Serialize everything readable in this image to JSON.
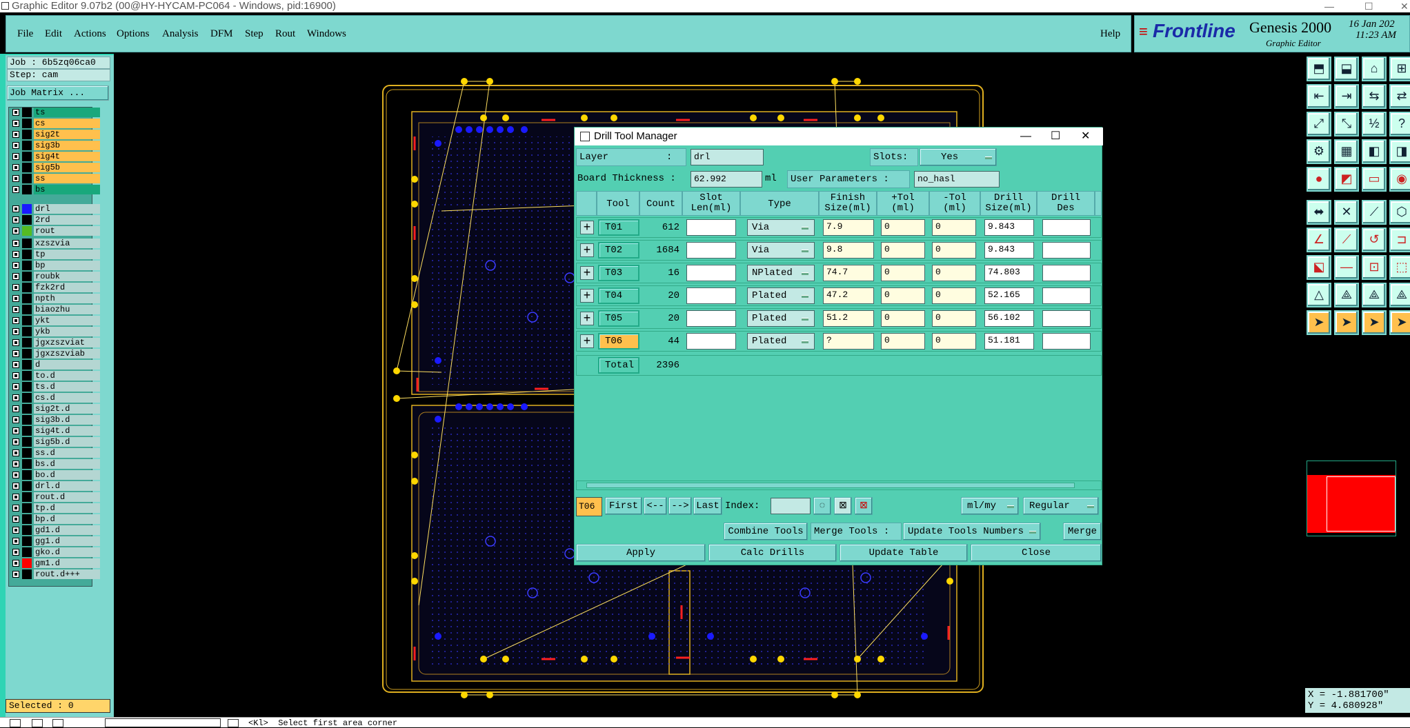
{
  "window": {
    "title": "Graphic Editor 9.07b2 (00@HY-HYCAM-PC064 - Windows, pid:16900)"
  },
  "menu": {
    "items": [
      "File",
      "Edit",
      "Actions",
      "Options",
      "Analysis",
      "DFM",
      "Step",
      "Rout",
      "Windows"
    ],
    "help": "Help"
  },
  "brand": {
    "logo": "Frontline",
    "product": "Genesis 2000",
    "subtitle": "Graphic Editor",
    "date": "16 Jan 202",
    "time": "11:23 AM"
  },
  "job": {
    "job_line": "Job : 6b5zq06ca0",
    "step_line": "Step: cam",
    "matrix_button": "Job Matrix ..."
  },
  "layers": [
    {
      "name": "ts",
      "color": "#19a87c"
    },
    {
      "name": "cs",
      "color": "#ffc04d"
    },
    {
      "name": "sig2t",
      "color": "#ffc04d"
    },
    {
      "name": "sig3b",
      "color": "#ffc04d"
    },
    {
      "name": "sig4t",
      "color": "#ffc04d"
    },
    {
      "name": "sig5b",
      "color": "#ffc04d"
    },
    {
      "name": "ss",
      "color": "#ffc04d"
    },
    {
      "name": "bs",
      "color": "#19a87c"
    },
    {
      "name": "drl",
      "color": "#b4d6d2",
      "swatch": "#1a1aff"
    },
    {
      "name": "2rd",
      "color": "#b4d6d2"
    },
    {
      "name": "rout",
      "color": "#b4d6d2",
      "swatch": "#55bb22"
    },
    {
      "name": "xzszvia",
      "color": "#b4d6d2"
    },
    {
      "name": "tp",
      "color": "#b4d6d2"
    },
    {
      "name": "bp",
      "color": "#b4d6d2"
    },
    {
      "name": "roubk",
      "color": "#b4d6d2"
    },
    {
      "name": "fzk2rd",
      "color": "#b4d6d2"
    },
    {
      "name": "npth",
      "color": "#b4d6d2"
    },
    {
      "name": "biaozhu",
      "color": "#b4d6d2"
    },
    {
      "name": "ykt",
      "color": "#b4d6d2"
    },
    {
      "name": "ykb",
      "color": "#b4d6d2"
    },
    {
      "name": "jgxzszviat",
      "color": "#b4d6d2"
    },
    {
      "name": "jgxzszviab",
      "color": "#b4d6d2"
    },
    {
      "name": "d",
      "color": "#b4d6d2"
    },
    {
      "name": "to.d",
      "color": "#b4d6d2"
    },
    {
      "name": "ts.d",
      "color": "#b4d6d2"
    },
    {
      "name": "cs.d",
      "color": "#b4d6d2"
    },
    {
      "name": "sig2t.d",
      "color": "#b4d6d2"
    },
    {
      "name": "sig3b.d",
      "color": "#b4d6d2"
    },
    {
      "name": "sig4t.d",
      "color": "#b4d6d2"
    },
    {
      "name": "sig5b.d",
      "color": "#b4d6d2"
    },
    {
      "name": "ss.d",
      "color": "#b4d6d2"
    },
    {
      "name": "bs.d",
      "color": "#b4d6d2"
    },
    {
      "name": "bo.d",
      "color": "#b4d6d2"
    },
    {
      "name": "drl.d",
      "color": "#b4d6d2"
    },
    {
      "name": "rout.d",
      "color": "#b4d6d2"
    },
    {
      "name": "tp.d",
      "color": "#b4d6d2"
    },
    {
      "name": "bp.d",
      "color": "#b4d6d2"
    },
    {
      "name": "gd1.d",
      "color": "#b4d6d2"
    },
    {
      "name": "gg1.d",
      "color": "#b4d6d2"
    },
    {
      "name": "gko.d",
      "color": "#b4d6d2"
    },
    {
      "name": "gm1.d",
      "color": "#b4d6d2",
      "swatch": "#ff0000"
    },
    {
      "name": "rout.d+++",
      "color": "#b4d6d2"
    }
  ],
  "selected": "Selected : 0",
  "coords": {
    "x": "X = -1.881700\"",
    "y": "Y = 4.680928\""
  },
  "dialog": {
    "title": "Drill Tool Manager",
    "layer_label": "Layer          :",
    "layer_value": "drl",
    "slots_label": "Slots:",
    "slots_value": "Yes",
    "thickness_label": "Board Thickness :",
    "thickness_value": "62.992",
    "thickness_unit": "ml",
    "user_params_label": "User Parameters :",
    "user_params_value": "no_hasl",
    "headers": [
      "Tool",
      "Count",
      "Slot\nLen(ml)",
      "Type",
      "Finish\nSize(ml)",
      "+Tol\n(ml)",
      "-Tol\n(ml)",
      "Drill\nSize(ml)",
      "Drill\nDes"
    ],
    "rows": [
      {
        "tool": "T01",
        "count": "612",
        "slot": "",
        "type": "Via",
        "finish": "7.9",
        "ptol": "0",
        "mtol": "0",
        "drill": "9.843",
        "des": ""
      },
      {
        "tool": "T02",
        "count": "1684",
        "slot": "",
        "type": "Via",
        "finish": "9.8",
        "ptol": "0",
        "mtol": "0",
        "drill": "9.843",
        "des": ""
      },
      {
        "tool": "T03",
        "count": "16",
        "slot": "",
        "type": "NPlated",
        "finish": "74.7",
        "ptol": "0",
        "mtol": "0",
        "drill": "74.803",
        "des": ""
      },
      {
        "tool": "T04",
        "count": "20",
        "slot": "",
        "type": "Plated",
        "finish": "47.2",
        "ptol": "0",
        "mtol": "0",
        "drill": "52.165",
        "des": ""
      },
      {
        "tool": "T05",
        "count": "20",
        "slot": "",
        "type": "Plated",
        "finish": "51.2",
        "ptol": "0",
        "mtol": "0",
        "drill": "56.102",
        "des": ""
      },
      {
        "tool": "T06",
        "count": "44",
        "slot": "",
        "type": "Plated",
        "finish": "?",
        "ptol": "0",
        "mtol": "0",
        "drill": "51.181",
        "des": ""
      }
    ],
    "total_label": "Total",
    "total_value": "2396",
    "current_tool": "T06",
    "nav": {
      "first": "First",
      "prev": "<--",
      "next": "-->",
      "last": "Last",
      "index_label": "Index:"
    },
    "units": "ml/my",
    "mode": "Regular",
    "combine": "Combine Tools",
    "merge_label": "Merge Tools :",
    "merge_option": "Update Tools Numbers",
    "merge_btn": "Merge",
    "apply": "Apply",
    "calc": "Calc Drills",
    "update": "Update Table",
    "close": "Close"
  },
  "status": {
    "prompt": "<Kl>  Select first area corner"
  }
}
